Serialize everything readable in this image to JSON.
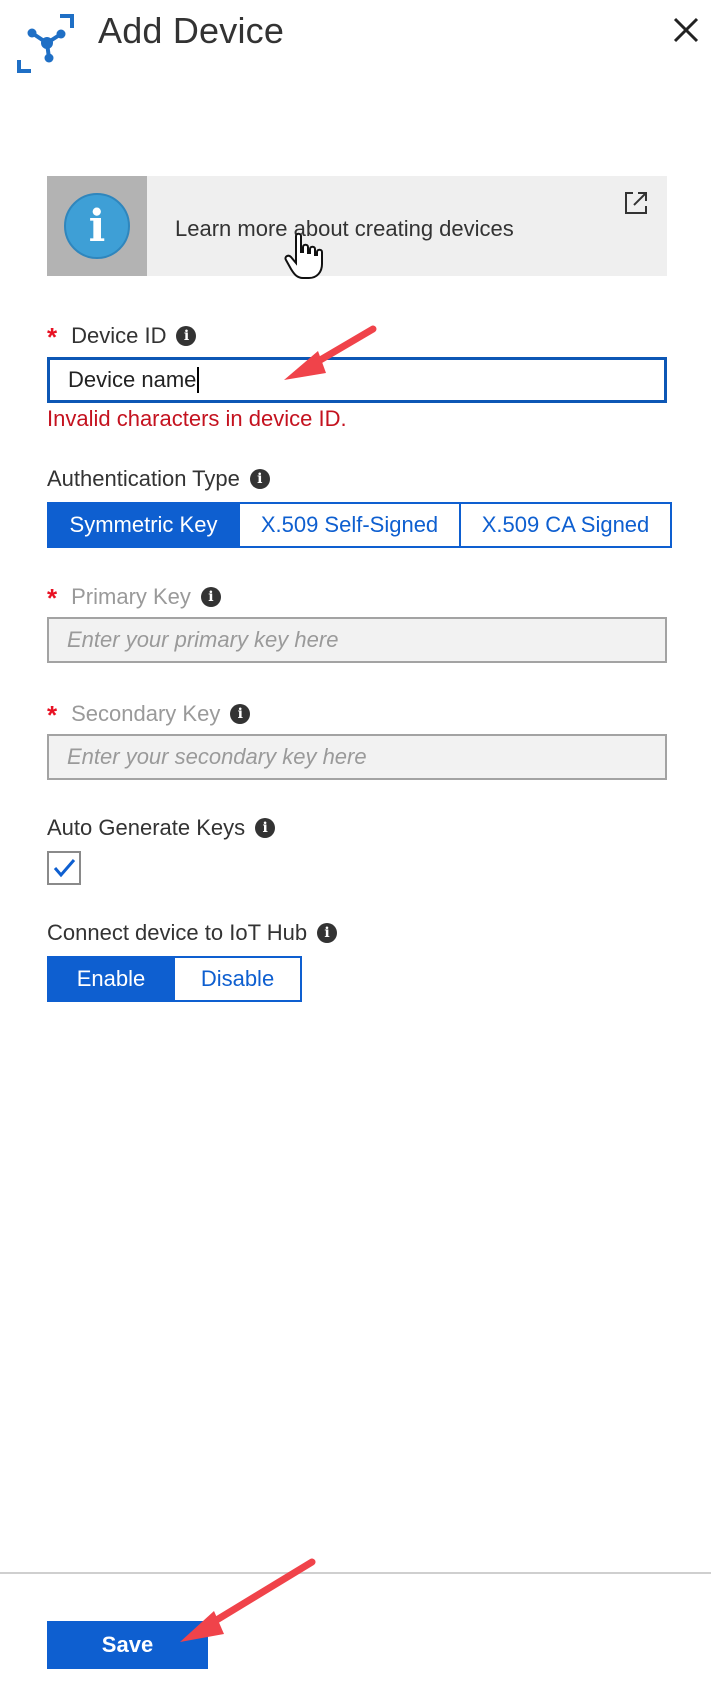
{
  "header": {
    "title": "Add Device",
    "logo_icon": "iot-hub-icon",
    "close_icon": "close-icon"
  },
  "info_banner": {
    "text": "Learn more about creating devices",
    "icon": "info-icon",
    "external_icon": "external-link-icon"
  },
  "device_id": {
    "label": "Device ID",
    "required_mark": "*",
    "value": "Device name",
    "error": "Invalid characters in device ID."
  },
  "auth_type": {
    "label": "Authentication Type",
    "options": [
      "Symmetric Key",
      "X.509 Self-Signed",
      "X.509 CA Signed"
    ],
    "selected": "Symmetric Key"
  },
  "primary_key": {
    "label": "Primary Key",
    "required_mark": "*",
    "placeholder": "Enter your primary key here"
  },
  "secondary_key": {
    "label": "Secondary Key",
    "required_mark": "*",
    "placeholder": "Enter your secondary key here"
  },
  "auto_generate": {
    "label": "Auto Generate Keys",
    "checked": true
  },
  "connect": {
    "label": "Connect device to IoT Hub",
    "options": [
      "Enable",
      "Disable"
    ],
    "selected": "Enable"
  },
  "footer": {
    "save_label": "Save"
  },
  "colors": {
    "accent": "#0e5fd0",
    "error": "#c4121f",
    "required": "#e81123",
    "annotation_arrow": "#f0434a"
  }
}
